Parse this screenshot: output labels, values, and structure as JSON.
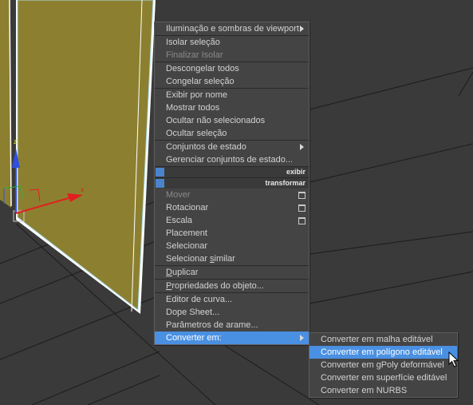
{
  "colors": {
    "viewport_bg": "#3a3a3a",
    "object_fill": "#8c8030",
    "selection_outline": "#ffffff",
    "menu_bg": "#444444",
    "highlight": "#4a90e2"
  },
  "gizmo": {
    "x_label": "x",
    "z_label": "z"
  },
  "quad_menu": {
    "items": [
      {
        "label": "Iluminação e sombras de viewport",
        "submenu": true
      },
      {
        "sep": true
      },
      {
        "label": "Isolar seleção"
      },
      {
        "label": "Finalizar Isolar",
        "disabled": true
      },
      {
        "sep": true
      },
      {
        "label": "Descongelar todos"
      },
      {
        "label": "Congelar seleção"
      },
      {
        "sep": true
      },
      {
        "label": "Exibir por nome"
      },
      {
        "label": "Mostrar todos"
      },
      {
        "label": "Ocultar não selecionados"
      },
      {
        "label": "Ocultar seleção"
      },
      {
        "sep": true
      },
      {
        "label": "Conjuntos de estado",
        "submenu": true
      },
      {
        "label": "Gerenciar conjuntos de estado..."
      }
    ],
    "quadrant_exibir": "exibir",
    "quadrant_transformar": "transformar",
    "transform_items": [
      {
        "label": "Mover",
        "box": true,
        "disabled": true
      },
      {
        "label": "Rotacionar",
        "box": true
      },
      {
        "label": "Escala",
        "box": true
      },
      {
        "label": "Placement"
      },
      {
        "label": "Selecionar"
      },
      {
        "label": "Selecionar similar"
      },
      {
        "sep": true
      },
      {
        "label": "Duplicar"
      },
      {
        "sep": true
      },
      {
        "label": "Propriedades do objeto..."
      },
      {
        "sep": true
      },
      {
        "label": "Editor de curva..."
      },
      {
        "label": "Dope Sheet..."
      },
      {
        "label": "Parâmetros de arame..."
      },
      {
        "label": "Converter em:",
        "submenu": true,
        "highlight": true
      }
    ]
  },
  "submenu_convert": {
    "items": [
      {
        "label": "Converter em malha editável"
      },
      {
        "label": "Converter em polígono editável",
        "highlight": true
      },
      {
        "label": "Converter em gPoly deformável"
      },
      {
        "label": "Converter em superfície editável"
      },
      {
        "label": "Converter em NURBS"
      }
    ]
  }
}
